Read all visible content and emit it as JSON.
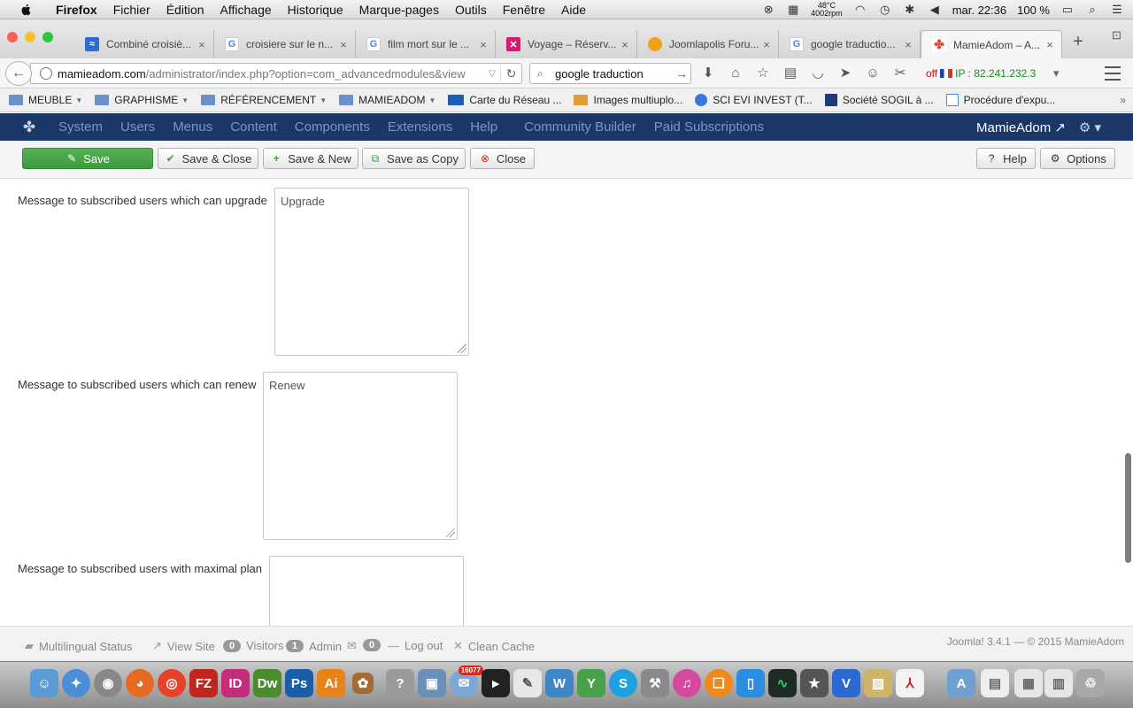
{
  "menubar": {
    "app_name": "Firefox",
    "menus": [
      "Fichier",
      "Édition",
      "Affichage",
      "Historique",
      "Marque-pages",
      "Outils",
      "Fenêtre",
      "Aide"
    ],
    "temp": "48°C",
    "rpm": "4002rpm",
    "clock": "mar. 22:36",
    "battery": "100 %"
  },
  "tabs": [
    {
      "label": "Combiné croisiè...",
      "icon": "ship-favicon",
      "color": "#2b6cd0"
    },
    {
      "label": "croisiere sur le n...",
      "icon": "google-favicon",
      "color": "#4285f4"
    },
    {
      "label": "film mort sur le ...",
      "icon": "google-favicon",
      "color": "#4285f4"
    },
    {
      "label": "Voyage – Réserv...",
      "icon": "voyage-favicon",
      "color": "#d81b70"
    },
    {
      "label": "Joomlapolis Foru...",
      "icon": "joomlapolis-favicon",
      "color": "#f0a01a"
    },
    {
      "label": "google traductio...",
      "icon": "google-favicon",
      "color": "#4285f4"
    },
    {
      "label": "MamieAdom – A...",
      "icon": "joomla-favicon",
      "color": "#e8492f"
    }
  ],
  "navbar": {
    "url_host": "mamieadom.com",
    "url_path": "/administrator/index.php?option=com_advancedmodules&view",
    "search_value": "google traduction",
    "ip_off": "off",
    "ip_label": "IP : 82.241.232.3"
  },
  "bookmarks": [
    {
      "label": "MEUBLE",
      "folder": true
    },
    {
      "label": "GRAPHISME",
      "folder": true
    },
    {
      "label": "RÉFÉRENCEMENT",
      "folder": true
    },
    {
      "label": "MAMIEADOM",
      "folder": true
    },
    {
      "label": "Carte du Réseau ...",
      "folder": false
    },
    {
      "label": "Images multiuplo...",
      "folder": false
    },
    {
      "label": "SCI EVI INVEST (T...",
      "folder": false
    },
    {
      "label": "Société SOGIL à ...",
      "folder": false
    },
    {
      "label": "Procédure d'expu...",
      "folder": false
    }
  ],
  "admin_menu": {
    "items": [
      "System",
      "Users",
      "Menus",
      "Content",
      "Components",
      "Extensions",
      "Help",
      "Community Builder",
      "Paid Subscriptions"
    ],
    "site_name": "MamieAdom"
  },
  "toolbar": {
    "save": "Save",
    "save_close": "Save & Close",
    "save_new": "Save & New",
    "save_copy": "Save as Copy",
    "close": "Close",
    "help": "Help",
    "options": "Options"
  },
  "fields": [
    {
      "label": "Message to subscribed users which can upgrade",
      "value": "Upgrade"
    },
    {
      "label": "Message to subscribed users which can renew",
      "value": "Renew"
    },
    {
      "label": "Message to subscribed users with maximal plan",
      "value": ""
    }
  ],
  "statusbar": {
    "multilingual": "Multilingual Status",
    "view_site": "View Site",
    "visitors_count": "0",
    "visitors_label": "Visitors",
    "admin_count": "1",
    "admin_label": "Admin",
    "messages_count": "0",
    "logout": "Log out",
    "clean_cache": "Clean Cache",
    "version_note": "Joomla! 3.4.1  —  © 2015 MamieAdom"
  },
  "dock": {
    "items": [
      "Finder",
      "Safari",
      "Disk Utility",
      "Firefox",
      "Chrome",
      "FileZilla",
      "InDesign",
      "Dreamweaver",
      "Photoshop",
      "Illustrator",
      "Misc",
      "Help",
      "Preview",
      "Mail",
      "Terminal",
      "TextEdit",
      "Wunderlist",
      "Sourcetree",
      "Skype",
      "Tools",
      "iTunes",
      "iBooks",
      "Remote",
      "Activity Monitor",
      "Sky",
      "Vectorworks",
      "Photo",
      "Acrobat",
      "Applications",
      "Documents",
      "Downloads",
      "Files",
      "Trash"
    ],
    "mail_badge": "16077"
  },
  "colors": {
    "joomla_nav": "#1a3867",
    "save_green": "#3e9a3e"
  }
}
